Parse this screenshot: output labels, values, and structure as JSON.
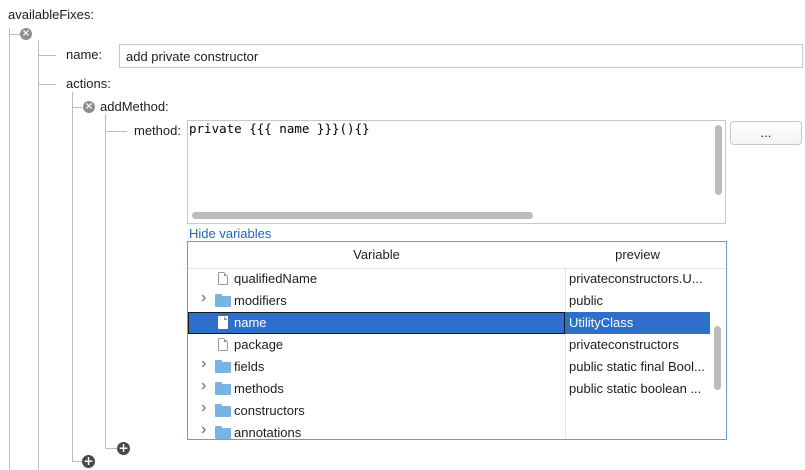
{
  "root_label": "availableFixes:",
  "fix": {
    "name_label": "name:",
    "name_value": "add private constructor",
    "actions_label": "actions:",
    "add_method_label": "addMethod:",
    "method_label": "method:",
    "method_code": "private {{{ name }}}(){}",
    "ellipsis_button": "...",
    "hide_variables_link": "Hide variables"
  },
  "variables_table": {
    "columns": [
      "Variable",
      "preview"
    ],
    "rows": [
      {
        "name": "qualifiedName",
        "preview": "privateconstructors.U...",
        "icon": "file-icon",
        "expandable": false,
        "selected": false
      },
      {
        "name": "modifiers",
        "preview": "public",
        "icon": "folder-icon",
        "expandable": true,
        "selected": false
      },
      {
        "name": "name",
        "preview": "UtilityClass",
        "icon": "file-icon",
        "expandable": false,
        "selected": true
      },
      {
        "name": "package",
        "preview": "privateconstructors",
        "icon": "file-icon",
        "expandable": false,
        "selected": false
      },
      {
        "name": "fields",
        "preview": "public static final Bool...",
        "icon": "folder-icon",
        "expandable": true,
        "selected": false
      },
      {
        "name": "methods",
        "preview": "public static boolean ...",
        "icon": "folder-icon",
        "expandable": true,
        "selected": false
      },
      {
        "name": "constructors",
        "preview": "",
        "icon": "folder-icon",
        "expandable": true,
        "selected": false
      },
      {
        "name": "annotations",
        "preview": "",
        "icon": "folder-icon",
        "expandable": true,
        "selected": false
      }
    ]
  },
  "colors": {
    "selection": "#2f6fcb",
    "link": "#2a64b3",
    "table_border": "#6f9bd1",
    "folder": "#77b3e3"
  },
  "icons": {
    "remove": "remove-circle-icon",
    "add": "add-circle-icon",
    "expand": "chevron-right-icon"
  }
}
